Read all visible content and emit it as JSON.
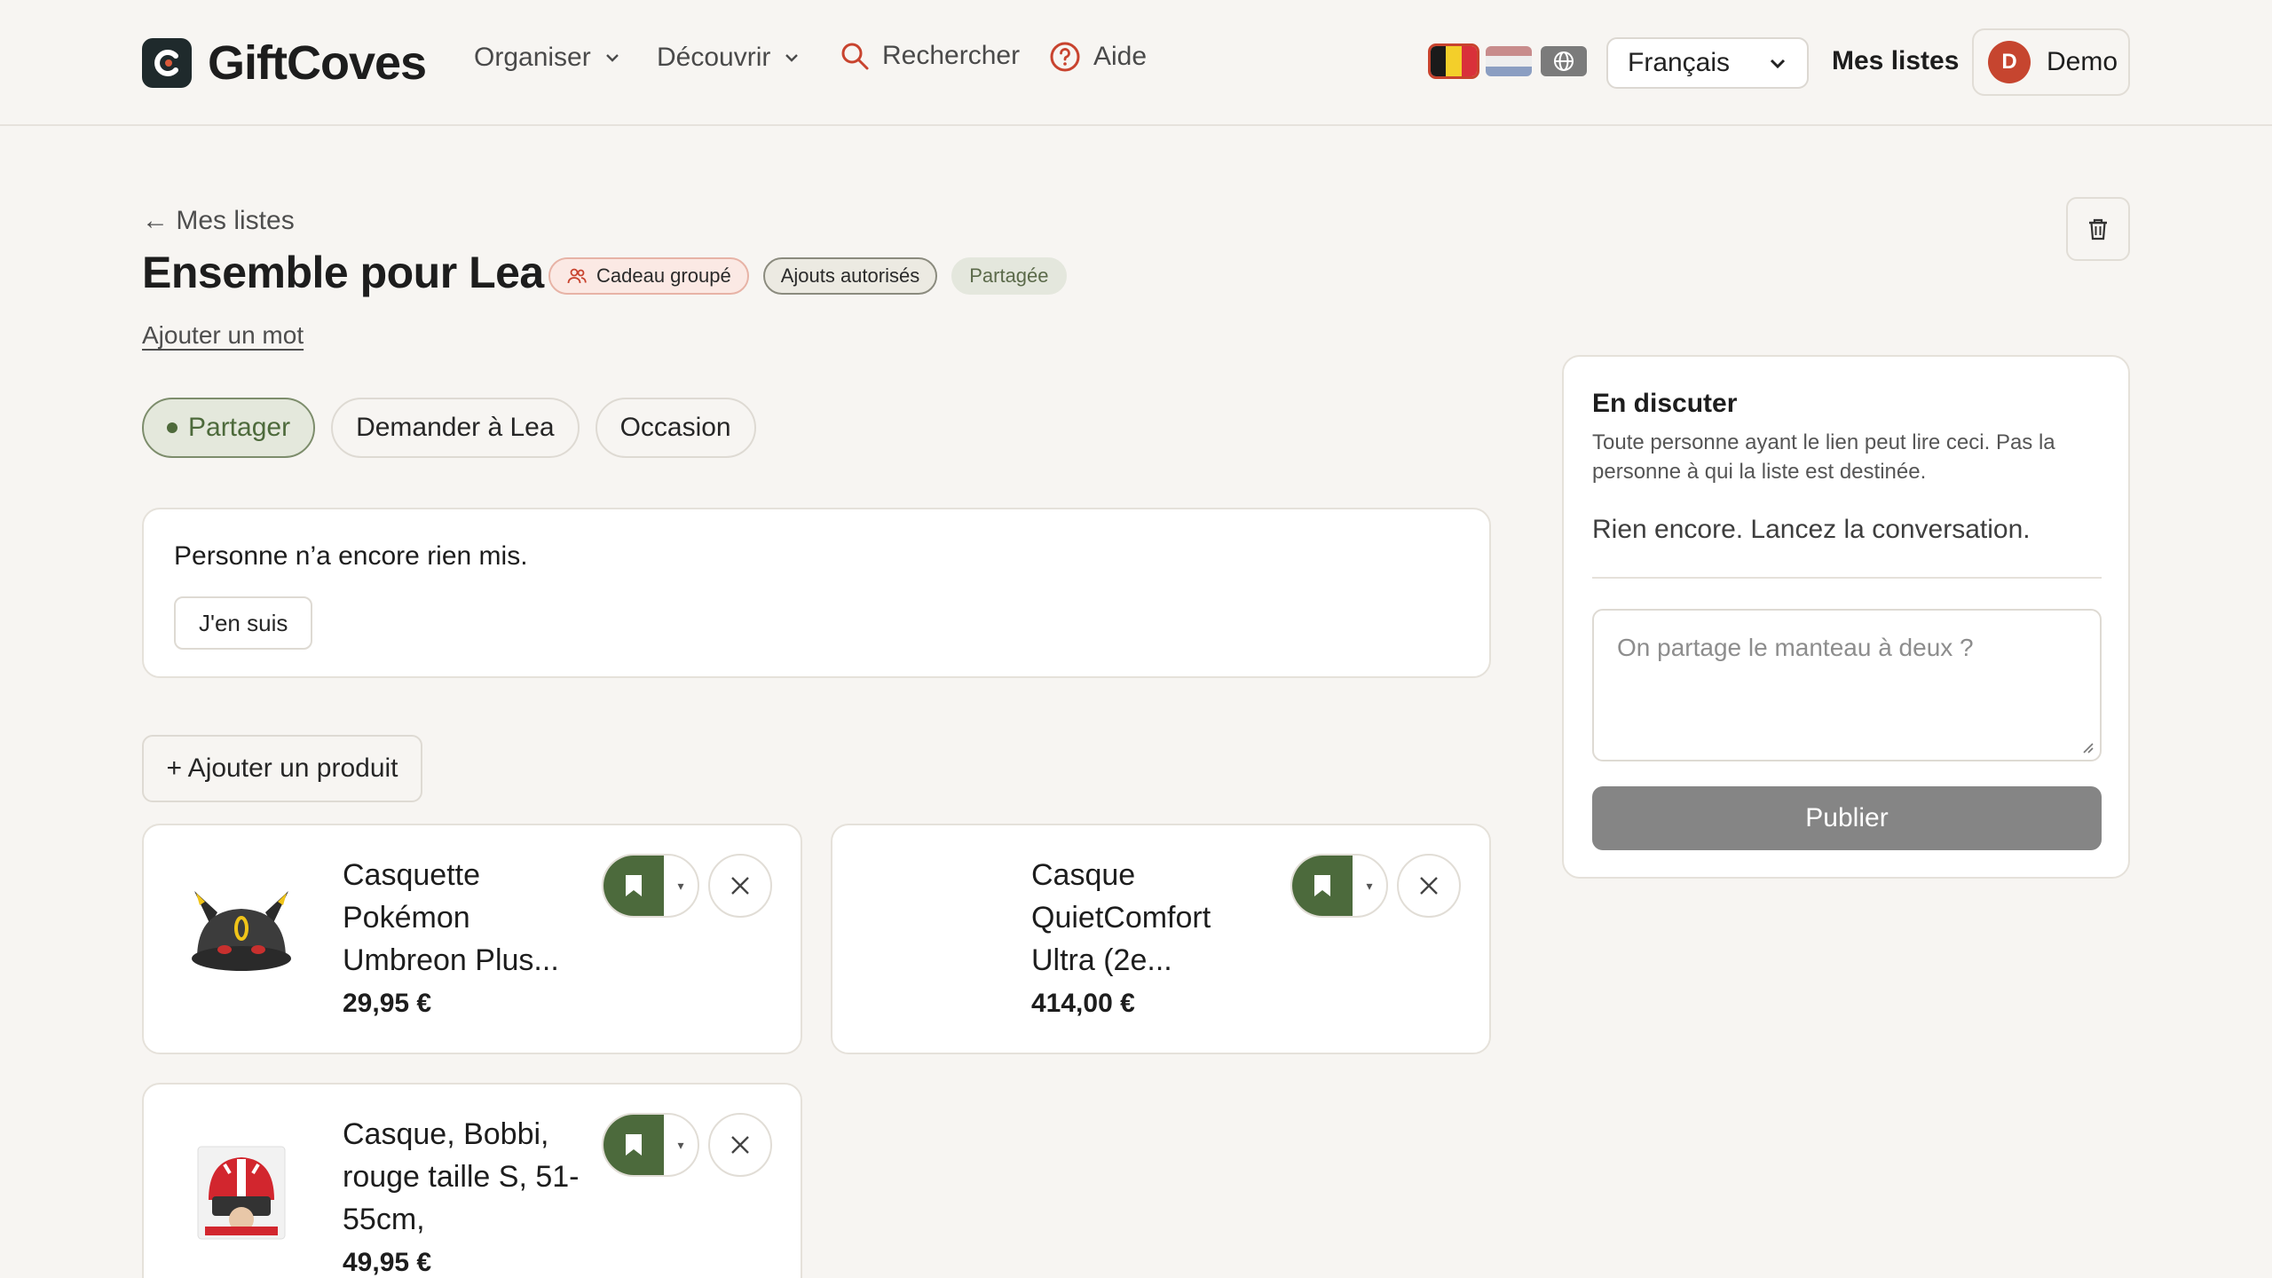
{
  "header": {
    "brand": "GiftCoves",
    "nav": {
      "organize": "Organiser",
      "discover": "Découvrir",
      "search": "Rechercher",
      "help": "Aide"
    },
    "flags": [
      "flag-belgium",
      "flag-netherlands",
      "globe-icon"
    ],
    "language": "Français",
    "my_lists": "Mes listes",
    "user": {
      "initial": "D",
      "name": "Demo"
    }
  },
  "list": {
    "back": "← Mes listes",
    "title": "Ensemble pour Lea",
    "badges": {
      "group_gift": "Cadeau groupé",
      "additions": "Ajouts autorisés",
      "shared": "Partagée"
    },
    "add_word": "Ajouter un mot",
    "tabs": [
      {
        "label": "Partager",
        "active": true
      },
      {
        "label": "Demander à Lea",
        "active": false
      },
      {
        "label": "Occasion",
        "active": false
      }
    ],
    "contributions": {
      "empty": "Personne n’a encore rien mis.",
      "join": "J'en suis"
    },
    "add_product": "+ Ajouter un produit",
    "products": [
      {
        "name": "Casquette Pokémon Umbreon Plus...",
        "price": "29,95 €"
      },
      {
        "name": "Casque QuietComfort Ultra (2e...",
        "price": "414,00 €"
      },
      {
        "name": "Casque, Bobbi, rouge taille S, 51-55cm,",
        "price": "49,95 €"
      }
    ]
  },
  "discussion": {
    "title": "En discuter",
    "subtitle": "Toute personne ayant le lien peut lire ceci. Pas la personne à qui la liste est destinée.",
    "empty": "Rien encore. Lancez la conversation.",
    "placeholder": "On partage le manteau à deux ?",
    "publish": "Publier"
  },
  "colors": {
    "accent_green": "#4c6a3c",
    "brand_red": "#c6452f",
    "background": "#f7f5f2"
  }
}
